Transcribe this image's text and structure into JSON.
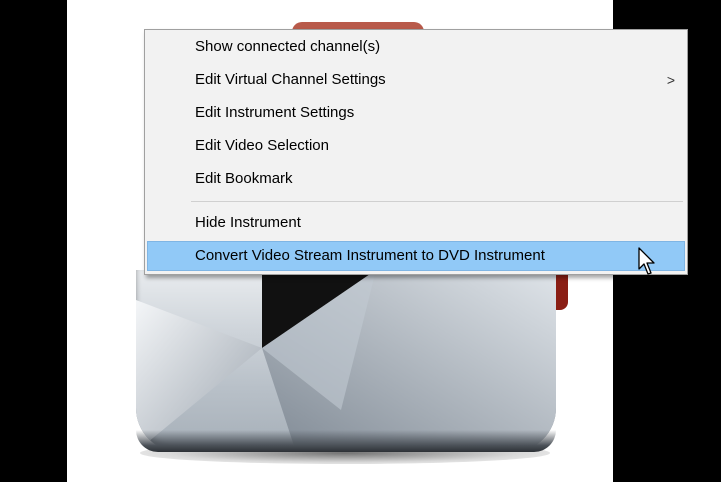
{
  "context_menu": {
    "items": [
      {
        "label": "Show connected channel(s)",
        "has_submenu": false,
        "highlighted": false
      },
      {
        "label": "Edit Virtual Channel Settings",
        "has_submenu": true,
        "highlighted": false
      },
      {
        "label": "Edit Instrument Settings",
        "has_submenu": false,
        "highlighted": false
      },
      {
        "label": "Edit Video Selection",
        "has_submenu": false,
        "highlighted": false
      },
      {
        "label": "Edit Bookmark",
        "has_submenu": false,
        "highlighted": false
      },
      {
        "label": "Hide Instrument",
        "has_submenu": false,
        "highlighted": false
      },
      {
        "label": "Convert Video Stream Instrument to DVD Instrument",
        "has_submenu": false,
        "highlighted": true
      }
    ],
    "submenu_glyph": ">"
  },
  "cursor": {
    "icon": "arrow-pointer-icon"
  },
  "colors": {
    "highlight": "#91c9f7",
    "menu_background": "#f2f2f2",
    "accent_red": "#8a1e14"
  }
}
